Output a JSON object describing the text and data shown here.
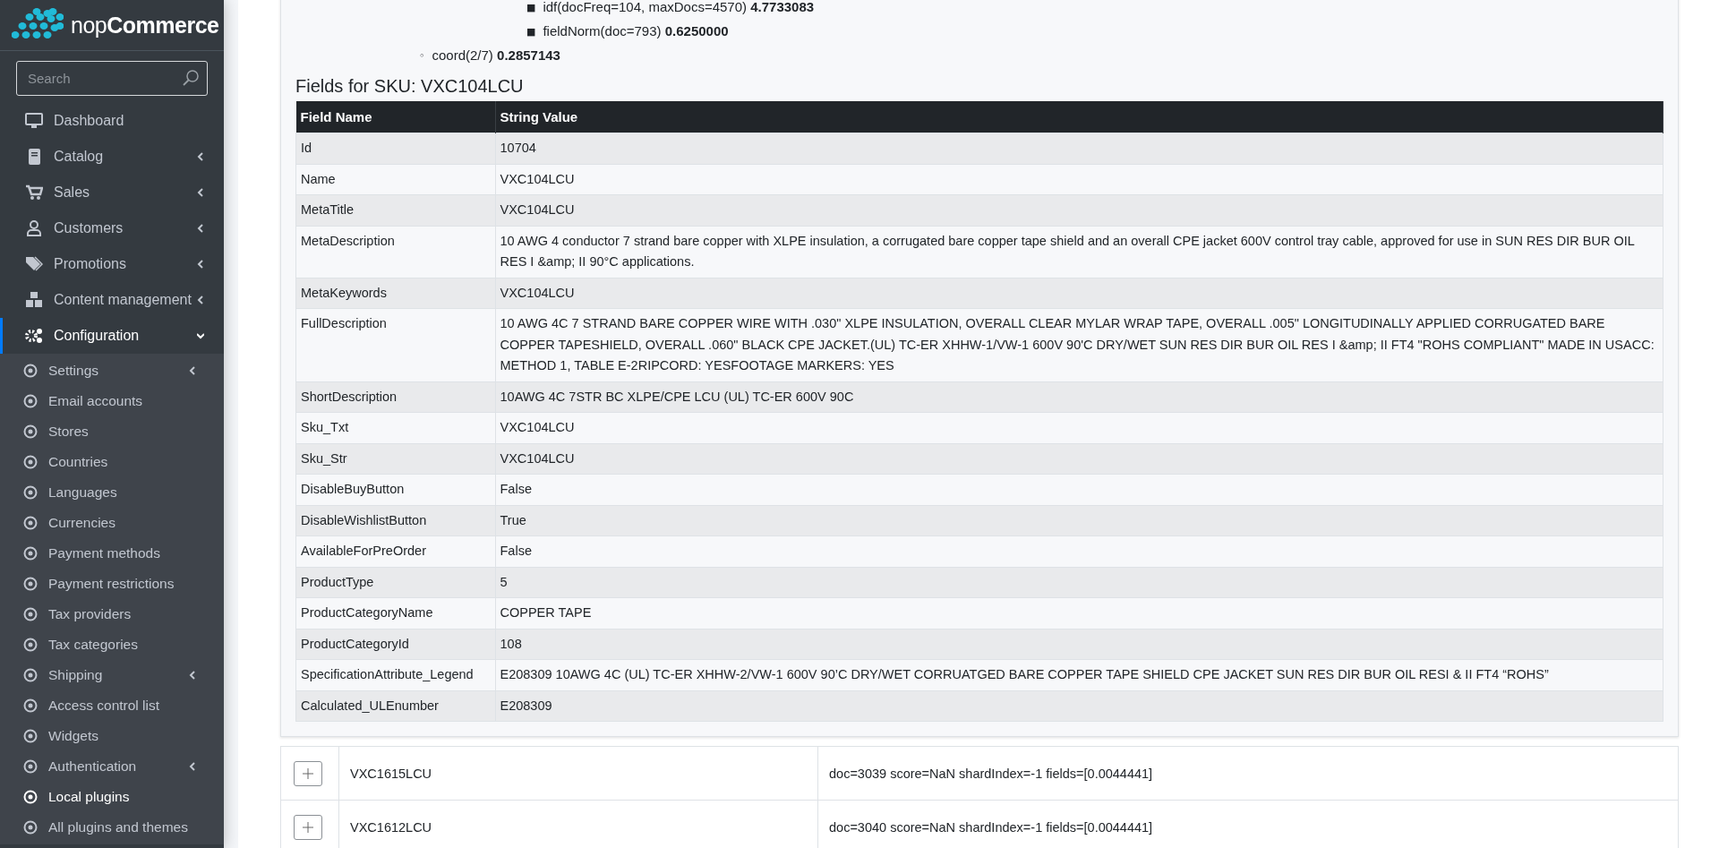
{
  "sidebar": {
    "logo": "nop**Commerce**",
    "search": {
      "placeholder": "Search"
    },
    "items": [
      {
        "label": "Dashboard",
        "expandable": false,
        "selected": false
      },
      {
        "label": "Catalog",
        "expandable": true,
        "expanded": false,
        "selected": false
      },
      {
        "label": "Sales",
        "expandable": true,
        "expanded": false,
        "selected": false
      },
      {
        "label": "Customers",
        "expandable": true,
        "expanded": false,
        "selected": false
      },
      {
        "label": "Promotions",
        "expandable": true,
        "expanded": false,
        "selected": false
      },
      {
        "label": "Content management",
        "expandable": true,
        "expanded": false,
        "selected": false
      },
      {
        "label": "Configuration",
        "expandable": true,
        "expanded": true,
        "selected": true,
        "children": [
          {
            "label": "Settings",
            "expandable": true,
            "selected": false
          },
          {
            "label": "Email accounts",
            "expandable": false,
            "selected": false
          },
          {
            "label": "Stores",
            "expandable": false,
            "selected": false
          },
          {
            "label": "Countries",
            "expandable": false,
            "selected": false
          },
          {
            "label": "Languages",
            "expandable": false,
            "selected": false
          },
          {
            "label": "Currencies",
            "expandable": false,
            "selected": false
          },
          {
            "label": "Payment methods",
            "expandable": false,
            "selected": false
          },
          {
            "label": "Payment restrictions",
            "expandable": false,
            "selected": false
          },
          {
            "label": "Tax providers",
            "expandable": false,
            "selected": false
          },
          {
            "label": "Tax categories",
            "expandable": false,
            "selected": false
          },
          {
            "label": "Shipping",
            "expandable": true,
            "selected": false
          },
          {
            "label": "Access control list",
            "expandable": false,
            "selected": false
          },
          {
            "label": "Widgets",
            "expandable": false,
            "selected": false
          },
          {
            "label": "Authentication",
            "expandable": true,
            "selected": false
          },
          {
            "label": "Local plugins",
            "expandable": false,
            "selected": true
          },
          {
            "label": "All plugins and themes",
            "expandable": false,
            "selected": false
          }
        ]
      }
    ]
  },
  "explanation": [
    {
      "children": [
        {
          "bullet": "■",
          "text": "idf(docFreq=104, maxDocs=4570)",
          "value": "4.7733083"
        },
        {
          "bullet": "■",
          "text": "fieldNorm(doc=793)",
          "value": "0.6250000"
        }
      ]
    },
    {
      "bullet": "◦",
      "text": "coord(2/7)",
      "value": "0.2857143"
    }
  ],
  "fields": {
    "title": "Fields for SKU: VXC104LCU",
    "columns": [
      "Field Name",
      "String Value"
    ],
    "rows": [
      [
        "Id",
        "10704"
      ],
      [
        "Name",
        "VXC104LCU"
      ],
      [
        "MetaTitle",
        "VXC104LCU"
      ],
      [
        "MetaDescription",
        "10 AWG 4 conductor 7 strand bare copper with XLPE insulation, a corrugated bare copper tape shield and an overall CPE jacket 600V control tray cable, approved for use in SUN RES DIR BUR OIL RES I &amp; II 90°C applications."
      ],
      [
        "MetaKeywords",
        "VXC104LCU"
      ],
      [
        "FullDescription",
        "10 AWG 4C 7 STRAND BARE COPPER WIRE WITH .030\" XLPE INSULATION, OVERALL CLEAR MYLAR WRAP TAPE, OVERALL .005\" LONGITUDINALLY APPLIED CORRUGATED BARE COPPER TAPESHIELD, OVERALL .060\" BLACK CPE JACKET.(UL) TC-ER XHHW-1/VW-1 600V 90'C DRY/WET SUN RES DIR BUR OIL RES I &amp; II FT4 \"ROHS COMPLIANT\" MADE IN USACC: METHOD 1, TABLE E-2RIPCORD: YESFOOTAGE MARKERS: YES"
      ],
      [
        "ShortDescription",
        "10AWG 4C 7STR BC XLPE/CPE LCU (UL) TC-ER 600V 90C"
      ],
      [
        "Sku_Txt",
        "VXC104LCU"
      ],
      [
        "Sku_Str",
        "VXC104LCU"
      ],
      [
        "DisableBuyButton",
        "False"
      ],
      [
        "DisableWishlistButton",
        "True"
      ],
      [
        "AvailableForPreOrder",
        "False"
      ],
      [
        "ProductType",
        "5"
      ],
      [
        "ProductCategoryName",
        "COPPER TAPE"
      ],
      [
        "ProductCategoryId",
        "108"
      ],
      [
        "SpecificationAttribute_Legend",
        "E208309 10AWG 4C (UL) TC-ER XHHW-2/VW-1 600V 90’C DRY/WET CORRUATGED BARE COPPER TAPE SHIELD CPE JACKET SUN RES DIR BUR OIL RESI & II FT4 “ROHS”"
      ],
      [
        "Calculated_ULEnumber",
        "E208309"
      ]
    ]
  },
  "results": [
    {
      "sku": "VXC1615LCU",
      "detail": "doc=3039 score=NaN shardIndex=-1 fields=[0.0044441]",
      "expanded": false
    },
    {
      "sku": "VXC1612LCU",
      "detail": "doc=3040 score=NaN shardIndex=-1 fields=[0.0044441]",
      "expanded": false
    }
  ]
}
